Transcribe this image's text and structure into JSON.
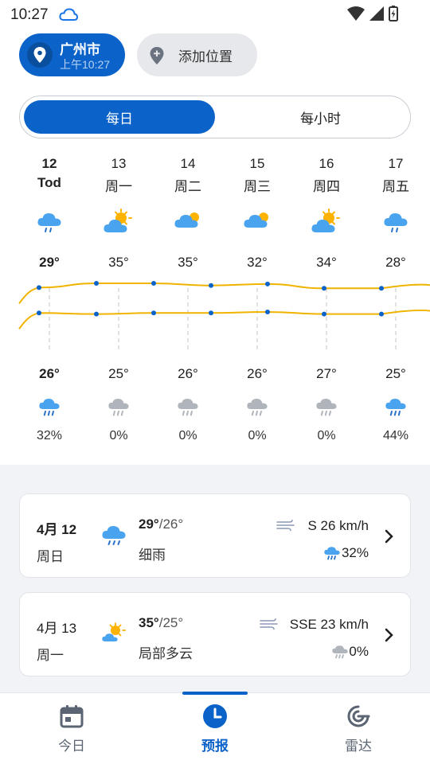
{
  "status_bar": {
    "time": "10:27"
  },
  "location": {
    "city": "广州市",
    "updated": "上午10:27",
    "add_label": "添加位置"
  },
  "segment": {
    "daily": "每日",
    "hourly": "每小时"
  },
  "days": [
    {
      "date": "12",
      "weekday": "Tod",
      "high": "29°",
      "low": "26°",
      "precip": "32%",
      "icon": "cloud-rain-icon"
    },
    {
      "date": "13",
      "weekday": "周一",
      "high": "35°",
      "low": "25°",
      "precip": "0%",
      "icon": "partly-sunny-icon"
    },
    {
      "date": "14",
      "weekday": "周二",
      "high": "35°",
      "low": "26°",
      "precip": "0%",
      "icon": "cloud-sun-icon"
    },
    {
      "date": "15",
      "weekday": "周三",
      "high": "32°",
      "low": "26°",
      "precip": "0%",
      "icon": "cloud-sun-icon"
    },
    {
      "date": "16",
      "weekday": "周四",
      "high": "34°",
      "low": "27°",
      "precip": "0%",
      "icon": "partly-sunny-icon"
    },
    {
      "date": "17",
      "weekday": "周五",
      "high": "28°",
      "low": "25°",
      "precip": "44%",
      "icon": "cloud-rain-icon"
    }
  ],
  "chart_data": {
    "type": "line",
    "categories": [
      "12",
      "13",
      "14",
      "15",
      "16",
      "17"
    ],
    "series": [
      {
        "values": [
          29,
          35,
          35,
          32,
          34,
          28
        ]
      },
      {
        "values": [
          26,
          25,
          26,
          26,
          27,
          25
        ]
      }
    ],
    "line_color": "#f0b400",
    "point_color": "#0b63c9"
  },
  "cards": [
    {
      "date": "4月 12",
      "weekday": "周日",
      "high": "29°",
      "low": "/26°",
      "desc": "细雨",
      "wind": "S  26 km/h",
      "rain": "32%",
      "icon": "cloud-rain-icon"
    },
    {
      "date": "4月 13",
      "weekday": "周一",
      "high": "35°",
      "low": "/25°",
      "desc": "局部多云",
      "wind": "SSE  23 km/h",
      "rain": "0%",
      "icon": "partly-sunny-icon"
    }
  ],
  "nav": {
    "today": "今日",
    "forecast": "预报",
    "radar": "雷达"
  },
  "colors": {
    "accent": "#0b63c9",
    "sun": "#ffb300",
    "cloud": "#4aa3ef"
  }
}
